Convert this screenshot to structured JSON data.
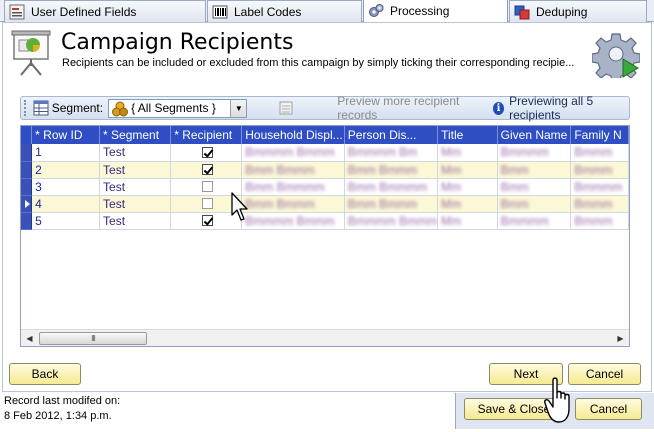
{
  "tabs": [
    {
      "label": "User Defined Fields",
      "icon": "form-icon"
    },
    {
      "label": "Label Codes",
      "icon": "barcode-icon"
    },
    {
      "label": "Processing",
      "icon": "gears-icon"
    },
    {
      "label": "Deduping",
      "icon": "dedupe-icon"
    }
  ],
  "header": {
    "title": "Campaign Recipients",
    "subtitle": "Recipients can be included or excluded from this campaign by simply ticking their corresponding recipie..."
  },
  "toolbar": {
    "segment_label": "Segment:",
    "segment_value": "{ All Segments }",
    "preview_more": "Preview more recipient records",
    "previewing": "Previewing all 5 recipients"
  },
  "grid": {
    "columns": [
      "* Row ID",
      "* Segment",
      "* Recipient",
      "Household Displ...",
      "Person Dis...",
      "Title",
      "Given Name",
      "Family N"
    ],
    "rows": [
      {
        "id": "1",
        "segment": "Test",
        "recipient": true,
        "household": "Bmmmm Bmmm",
        "person": "Bmmmm Bm",
        "title": "Mm",
        "given": "Bmmmm",
        "family": "Bmmm"
      },
      {
        "id": "2",
        "segment": "Test",
        "recipient": true,
        "household": "Bmm Bmmm",
        "person": "Bmm Bmmm",
        "title": "Mm",
        "given": "Bmm",
        "family": "Bmmm"
      },
      {
        "id": "3",
        "segment": "Test",
        "recipient": false,
        "household": "Bmm Bmmmm",
        "person": "Bmm Bmmmm",
        "title": "Mm",
        "given": "Bmm",
        "family": "Bmmmm"
      },
      {
        "id": "4",
        "segment": "Test",
        "recipient": false,
        "household": "Bmm Bmmm",
        "person": "Bmm Bmmm",
        "title": "Mm",
        "given": "Bmm",
        "family": "Bmmm"
      },
      {
        "id": "5",
        "segment": "Test",
        "recipient": true,
        "household": "Bmmmm Bmmm",
        "person": "Bmmmm Bmmm",
        "title": "Mm",
        "given": "Bmmmm",
        "family": "Bmmm"
      }
    ],
    "scroll_thumb_glyph": "III"
  },
  "buttons": {
    "back": "Back",
    "next": "Next",
    "cancel": "Cancel",
    "save_close": "Save & Close",
    "cancel2": "Cancel"
  },
  "status": {
    "line1": "Record last modifed on:",
    "line2": "8 Feb 2012, 1:34 p.m."
  },
  "colors": {
    "header_blue": "#2f4ec4",
    "alt_row": "#fbf8d6",
    "button_yellow": "#f6ea90"
  }
}
